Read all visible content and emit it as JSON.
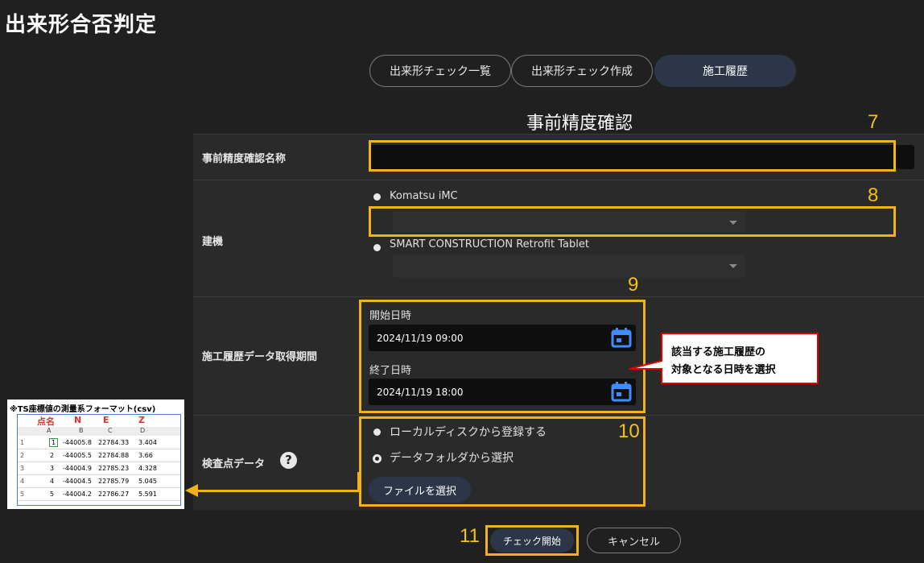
{
  "app_title": "出来形合否判定",
  "tabs": [
    {
      "label": "出来形チェック一覧",
      "active": false
    },
    {
      "label": "出来形チェック作成",
      "active": false
    },
    {
      "label": "施工履歴",
      "active": true
    }
  ],
  "section_heading": "事前精度確認",
  "form": {
    "name_row": {
      "label": "事前精度確認名称",
      "value": ""
    },
    "machine_row": {
      "label": "建機",
      "option1": "Komatsu iMC",
      "option2": "SMART CONSTRUCTION Retrofit Tablet"
    },
    "period_row": {
      "label": "施工履歴データ取得期間",
      "start_label": "開始日時",
      "start_value": "2024/11/19 09:00",
      "end_label": "終了日時",
      "end_value": "2024/11/19 18:00"
    },
    "inspection_row": {
      "label": "検査点データ",
      "option_local": "ローカルディスクから登録する",
      "option_folder": "データフォルダから選択",
      "file_button": "ファイルを選択"
    }
  },
  "buttons": {
    "check_start": "チェック開始",
    "cancel": "キャンセル"
  },
  "annotations": {
    "n7": "7",
    "n8": "8",
    "n9": "9",
    "n10": "10",
    "n11": "11",
    "callout_line1": "該当する施工履歴の",
    "callout_line2": "対象となる日時を選択"
  },
  "csv_sample": {
    "caption": "※TS座標値の測量系フォーマット(csv)",
    "header_labels": [
      "点名",
      "N",
      "E",
      "Z"
    ],
    "col_letters": [
      "A",
      "B",
      "C",
      "D"
    ],
    "rows": [
      [
        "1",
        "1",
        "-44005.8",
        "22784.33",
        "3.404"
      ],
      [
        "2",
        "2",
        "-44005.5",
        "22784.88",
        "3.66"
      ],
      [
        "3",
        "3",
        "-44004.9",
        "22785.23",
        "4.328"
      ],
      [
        "4",
        "4",
        "-44004.5",
        "22785.79",
        "5.045"
      ],
      [
        "5",
        "5",
        "-44004.2",
        "22786.27",
        "5.591"
      ]
    ]
  },
  "colors": {
    "accent_yellow": "#f2b21b",
    "callout_red": "#e00000",
    "calendar_blue": "#3f8cff",
    "active_tab": "#2d3548"
  }
}
